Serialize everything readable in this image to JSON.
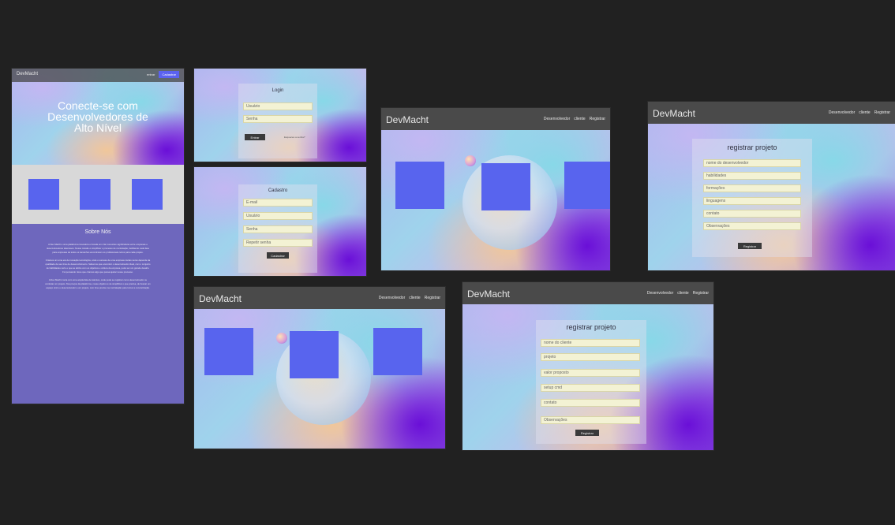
{
  "brand": "DevMacht",
  "landing": {
    "nav_links": [
      "entrar",
      "Cadastrar"
    ],
    "hero_title_lines": [
      "Conecte-se com",
      "Desenvolvedores de",
      "Alto Nível"
    ],
    "about_title": "Sobre Nós",
    "about_paragraphs": [
      "A Dev Macht é uma plataforma inovadora e focada em criar conexões significativas entre empresas e desenvolvedores talentosos. Nossa missão é simplificar o processo de contratação, facilitando cada fase para empresas de todos os tamanhos encontrarem os profissionais certos para cada projeto.",
      "Criamos um uma era de inovação tecnológica, onde o sucesso de uma empresa muitas vezes depende da qualidade de seu time de desenvolvimento. Sabemos que encontrar o desenvolvedor ideal, com o conjunto de habilidades certo e que se alinhe com os objetivos e cultura da empresa, pode ser um grande desafio. Foi pensando nisso que criamos algo que possa ajudar nesse processo.",
      "A Dev Macht conta com uma ampla lista de talentos, onde pode se registrar como desenvolvedor ou contratar um projeto. Nos preços da plataforma, nosso objetivo é de simplificar o que precisa, de buscar um espaço único e desenvolvedor a um projeto, com time preciso na contratação para tornar a concretização."
    ]
  },
  "login": {
    "title": "Login",
    "fields": [
      "Usuário",
      "Senha"
    ],
    "button": "Entrar",
    "link": "Esqueceu a senha?"
  },
  "signup": {
    "title": "Cadastro",
    "fields": [
      "E-mail",
      "Usuário",
      "Senha",
      "Repetir senha"
    ],
    "button": "Cadastrar"
  },
  "main_nav": {
    "links": [
      "Desenvolvedor",
      "cliente",
      "Registrar"
    ]
  },
  "register_dev": {
    "title": "registrar projeto",
    "fields": [
      "nome do desenvolvedor",
      "habilidades",
      "formações",
      "linguagens",
      "contato",
      "Observações"
    ],
    "button": "Registrar"
  },
  "register_client": {
    "title": "registrar projeto",
    "fields": [
      "nome do cliente",
      "projeto",
      "valor proposto",
      "setup cmd",
      "contato",
      "Observações"
    ],
    "button": "Registrar"
  },
  "colors": {
    "canvas": "#212121",
    "navbar": "#4a4a4a",
    "accent_square": "#5864ee",
    "about_bg": "#6e67bd",
    "field_bg": "#f3f2d4",
    "cadastrar_btn": "#5b62f0"
  }
}
